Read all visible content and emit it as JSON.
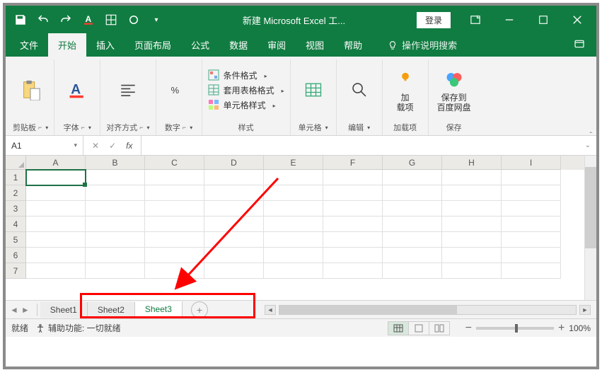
{
  "title": "新建 Microsoft Excel 工...",
  "login": "登录",
  "tabs": {
    "file": "文件",
    "home": "开始",
    "insert": "插入",
    "layout": "页面布局",
    "formula": "公式",
    "data": "数据",
    "review": "审阅",
    "view": "视图",
    "help": "帮助"
  },
  "tellme": "操作说明搜索",
  "groups": {
    "clipboard": "剪贴板",
    "font": "字体",
    "align": "对齐方式",
    "number": "数字",
    "styles": "样式",
    "cells": "单元格",
    "edit": "编辑",
    "addin": "加载项",
    "save": "保存"
  },
  "styles": {
    "cond": "条件格式",
    "table": "套用表格格式",
    "cell": "单元格样式"
  },
  "addin_btn": "加\n载项",
  "save_btn": "保存到\n百度网盘",
  "namebox": "A1",
  "cols": [
    "A",
    "B",
    "C",
    "D",
    "E",
    "F",
    "G",
    "H",
    "I"
  ],
  "rows": [
    "1",
    "2",
    "3",
    "4",
    "5",
    "6",
    "7"
  ],
  "sheets": [
    "Sheet1",
    "Sheet2",
    "Sheet3"
  ],
  "active_sheet": "Sheet3",
  "status_ready": "就绪",
  "status_acc": "辅助功能: 一切就绪",
  "zoom": "100%"
}
